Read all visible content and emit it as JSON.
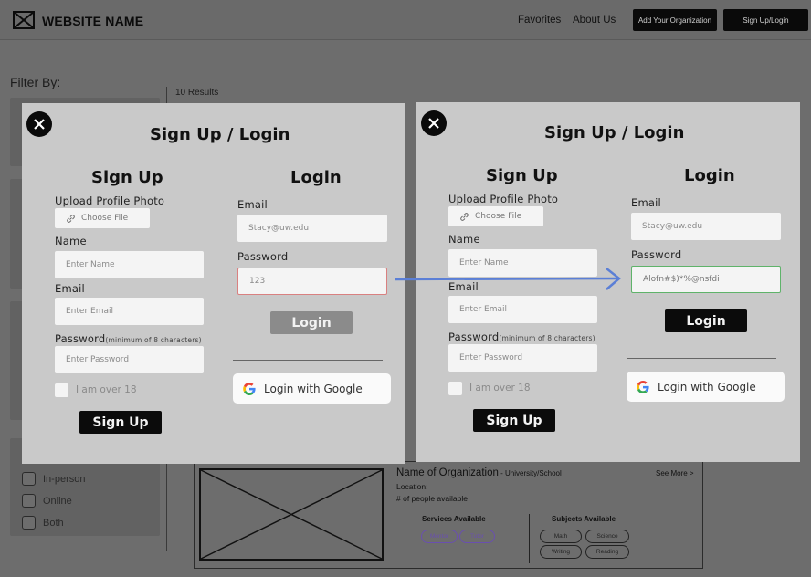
{
  "navbar": {
    "site_name": "WEBSITE NAME",
    "links": [
      "Favorites",
      "About Us"
    ],
    "add_org_label": "Add Your Organization",
    "signup_label": "Sign Up/Login"
  },
  "filters": {
    "title": "Filter By:",
    "options": [
      "In-person",
      "Online",
      "Both"
    ]
  },
  "results": {
    "count": "10 Results",
    "card": {
      "name": "Name of Organization",
      "type": " - University/School",
      "see_more": "See More >",
      "location": "Location:",
      "people": "# of people available",
      "services_title": "Services Available",
      "services": [
        "Mentor",
        "Tutor"
      ],
      "subjects_title": "Subjects Available",
      "subjects": [
        "Math",
        "Science",
        "Writing",
        "Reading"
      ]
    }
  },
  "modals": [
    {
      "title": "Sign Up / Login",
      "signup": {
        "title": "Sign Up",
        "photo_label": "Upload Profile Photo",
        "choose_file": "Choose File",
        "name_label": "Name",
        "name_placeholder": "Enter Name",
        "email_label": "Email",
        "email_placeholder": "Enter Email",
        "password_label": "Password",
        "password_hint": "(minimum of 8 characters)",
        "password_placeholder": "Enter Password",
        "age_label": "I am over 18",
        "button": "Sign Up"
      },
      "login": {
        "title": "Login",
        "email_label": "Email",
        "email_value": "Stacy@uw.edu",
        "password_label": "Password",
        "password_value": "123",
        "button": "Login",
        "google_button": "Login with Google"
      }
    },
    {
      "title": "Sign Up / Login",
      "signup": {
        "title": "Sign Up",
        "photo_label": "Upload Profile Photo",
        "choose_file": "Choose File",
        "name_label": "Name",
        "name_placeholder": "Enter Name",
        "email_label": "Email",
        "email_placeholder": "Enter Email",
        "password_label": "Password",
        "password_hint": "(minimum of 8 characters)",
        "password_placeholder": "Enter Password",
        "age_label": "I am over 18",
        "button": "Sign Up"
      },
      "login": {
        "title": "Login",
        "email_label": "Email",
        "email_value": "Stacy@uw.edu",
        "password_label": "Password",
        "password_value": "Alofn#$)*%@nsfdi",
        "button": "Login",
        "google_button": "Login with Google"
      }
    }
  ],
  "colors": {
    "overlay": "#6d6d6d",
    "modal": "#c9c9c9",
    "arrow": "#5b7fd6",
    "error_border": "#d98080",
    "success_border": "#5fb36a"
  }
}
